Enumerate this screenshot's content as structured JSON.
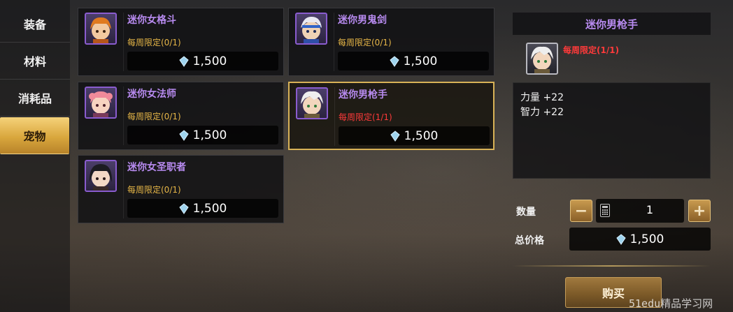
{
  "tabs": [
    {
      "label": "装备",
      "active": false
    },
    {
      "label": "材料",
      "active": false
    },
    {
      "label": "消耗品",
      "active": false
    },
    {
      "label": "宠物",
      "active": true
    }
  ],
  "items": [
    {
      "name": "迷你女格斗",
      "limit": "每周限定(0/1)",
      "price": "1,500",
      "selected": false
    },
    {
      "name": "迷你男鬼剑",
      "limit": "每周限定(0/1)",
      "price": "1,500",
      "selected": false
    },
    {
      "name": "迷你女法师",
      "limit": "每周限定(0/1)",
      "price": "1,500",
      "selected": false
    },
    {
      "name": "迷你男枪手",
      "limit": "每周限定(1/1)",
      "price": "1,500",
      "selected": true
    },
    {
      "name": "迷你女圣职者",
      "limit": "每周限定(0/1)",
      "price": "1,500",
      "selected": false
    }
  ],
  "detail": {
    "title": "迷你男枪手",
    "limit": "每周限定(1/1)",
    "stats": [
      "力量 +22",
      "智力 +22"
    ],
    "quantity_label": "数量",
    "quantity_value": "1",
    "minus": "−",
    "plus": "+",
    "total_label": "总价格",
    "total_value": "1,500",
    "buy_label": "购买"
  },
  "icons": {
    "currency": "gem-icon",
    "calculator": "calculator-icon"
  },
  "colors": {
    "name_purple": "#b88bf0",
    "limit_gold": "#e6b647",
    "limit_red": "#ff3a3a",
    "tab_active": "#d9a73d"
  },
  "watermark": "51edu精品学习网"
}
